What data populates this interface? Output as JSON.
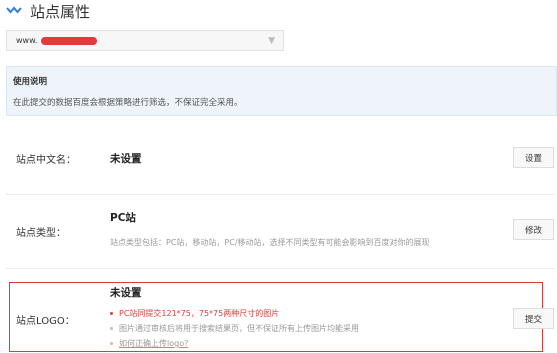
{
  "header": {
    "title": "站点属性"
  },
  "site_selector": {
    "value": "www."
  },
  "notice": {
    "title": "使用说明",
    "text": "在此提交的数据百度会根据策略进行筛选，不保证完全采用。"
  },
  "rows": {
    "chinese_name": {
      "label": "站点中文名：",
      "value": "未设置",
      "button": "设置"
    },
    "site_type": {
      "label": "站点类型：",
      "value": "PC站",
      "description": "站点类型包括：PC站，移动站，PC/移动站，选择不同类型有可能会影响到百度对你的展现",
      "button": "修改"
    },
    "logo": {
      "label": "站点LOGO：",
      "value": "未设置",
      "tips": [
        "PC站同提交121*75，75*75两种尺寸的图片",
        "图片通过审核后将用于搜索结果页，但不保证所有上传图片均能采用"
      ],
      "help_link": "如何正确上传logo?",
      "button": "提交"
    }
  },
  "colors": {
    "accent_blue": "#2d7ed6",
    "highlight_red": "#d93a3a"
  }
}
